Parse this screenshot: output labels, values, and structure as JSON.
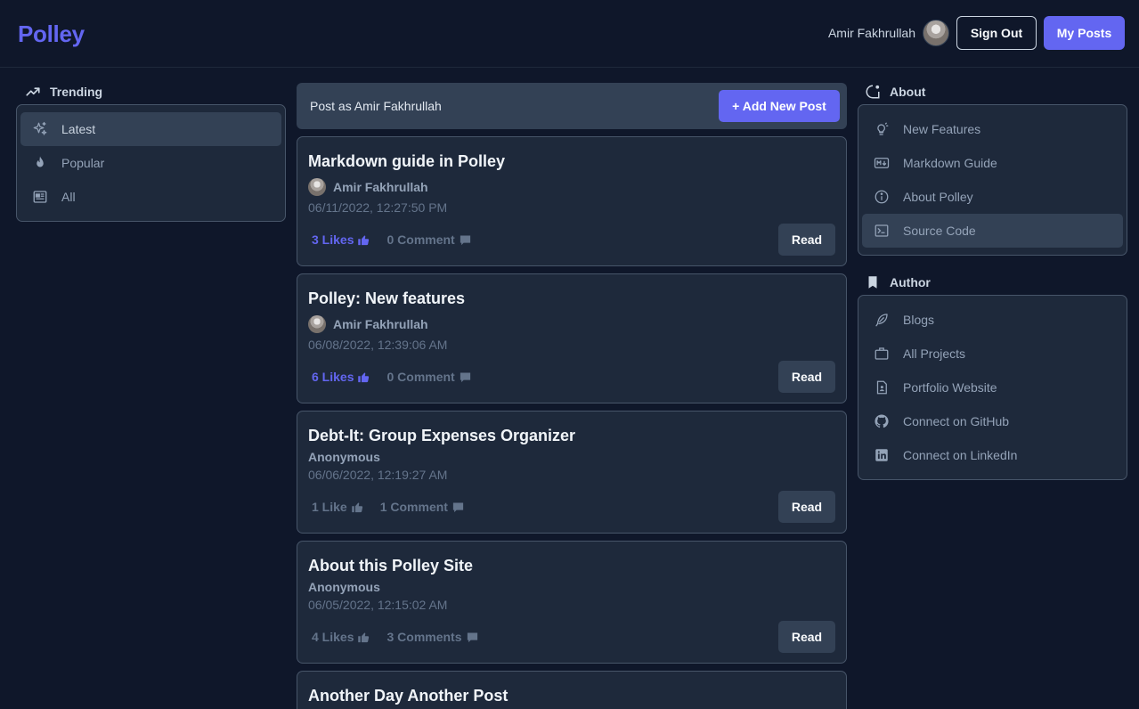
{
  "app": {
    "logo": "Polley"
  },
  "header": {
    "user_name": "Amir Fakhrullah",
    "sign_out_label": "Sign Out",
    "my_posts_label": "My Posts"
  },
  "trending": {
    "heading": "Trending",
    "items": [
      {
        "label": "Latest",
        "icon": "sparkles-icon",
        "active": true
      },
      {
        "label": "Popular",
        "icon": "fire-icon",
        "active": false
      },
      {
        "label": "All",
        "icon": "newspaper-icon",
        "active": false
      }
    ]
  },
  "composer": {
    "label": "Post as Amir Fakhrullah",
    "add_button": "+ Add New Post"
  },
  "posts": [
    {
      "title": "Markdown guide in Polley",
      "author": "Amir Fakhrullah",
      "has_avatar": true,
      "date": "06/11/2022, 12:27:50 PM",
      "likes": "3 Likes",
      "liked": true,
      "comments": "0 Comment",
      "read": "Read"
    },
    {
      "title": "Polley: New features",
      "author": "Amir Fakhrullah",
      "has_avatar": true,
      "date": "06/08/2022, 12:39:06 AM",
      "likes": "6 Likes",
      "liked": true,
      "comments": "0 Comment",
      "read": "Read"
    },
    {
      "title": "Debt-It: Group Expenses Organizer",
      "author": "Anonymous",
      "has_avatar": false,
      "date": "06/06/2022, 12:19:27 AM",
      "likes": "1 Like",
      "liked": false,
      "comments": "1 Comment",
      "read": "Read"
    },
    {
      "title": "About this Polley Site",
      "author": "Anonymous",
      "has_avatar": false,
      "date": "06/05/2022, 12:15:02 AM",
      "likes": "4 Likes",
      "liked": false,
      "comments": "3 Comments",
      "read": "Read"
    },
    {
      "title": "Another Day Another Post"
    }
  ],
  "about": {
    "heading": "About",
    "items": [
      {
        "label": "New Features",
        "icon": "lightbulb-icon",
        "active": false
      },
      {
        "label": "Markdown Guide",
        "icon": "markdown-icon",
        "active": false
      },
      {
        "label": "About Polley",
        "icon": "info-icon",
        "active": false
      },
      {
        "label": "Source Code",
        "icon": "terminal-icon",
        "active": true
      }
    ]
  },
  "author": {
    "heading": "Author",
    "items": [
      {
        "label": "Blogs",
        "icon": "feather-icon"
      },
      {
        "label": "All Projects",
        "icon": "briefcase-icon"
      },
      {
        "label": "Portfolio Website",
        "icon": "profile-document-icon"
      },
      {
        "label": "Connect on GitHub",
        "icon": "github-icon"
      },
      {
        "label": "Connect on LinkedIn",
        "icon": "linkedin-icon"
      }
    ]
  },
  "colors": {
    "background": "#0f172a",
    "panel": "#1e293b",
    "accent": "#6366f1",
    "active_item": "#334155"
  }
}
